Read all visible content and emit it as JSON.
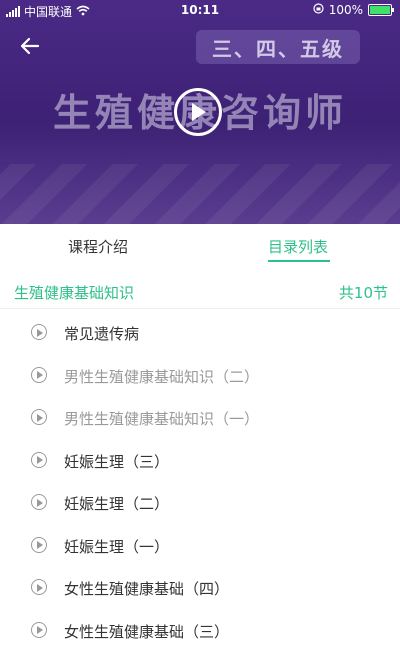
{
  "status_bar": {
    "carrier": "中国联通",
    "time": "10:11",
    "battery": "100%"
  },
  "video": {
    "level_badge": "三、四、五级",
    "headline": "生殖健康咨询师"
  },
  "tabs": [
    {
      "label": "课程介绍",
      "active": false
    },
    {
      "label": "目录列表",
      "active": true
    }
  ],
  "section": {
    "title": "生殖健康基础知识",
    "count": "共10节"
  },
  "lessons": [
    {
      "title": "常见遗传病",
      "state": "active"
    },
    {
      "title": "男性生殖健康基础知识（二）",
      "state": "inactive"
    },
    {
      "title": "男性生殖健康基础知识（一）",
      "state": "inactive"
    },
    {
      "title": "妊娠生理（三）",
      "state": "active"
    },
    {
      "title": "妊娠生理（二）",
      "state": "active"
    },
    {
      "title": "妊娠生理（一）",
      "state": "active"
    },
    {
      "title": "女性生殖健康基础（四）",
      "state": "active"
    },
    {
      "title": "女性生殖健康基础（三）",
      "state": "active"
    }
  ],
  "colors": {
    "accent": "#2ec08a",
    "video_bg": "#4a2a86",
    "inactive_text": "#9a9a9a"
  },
  "icons": {
    "back": "arrow-left-icon",
    "play": "play-icon",
    "lesson": "play-circle-icon",
    "wifi": "wifi-icon",
    "lock": "orientation-lock-icon",
    "battery": "battery-icon"
  }
}
